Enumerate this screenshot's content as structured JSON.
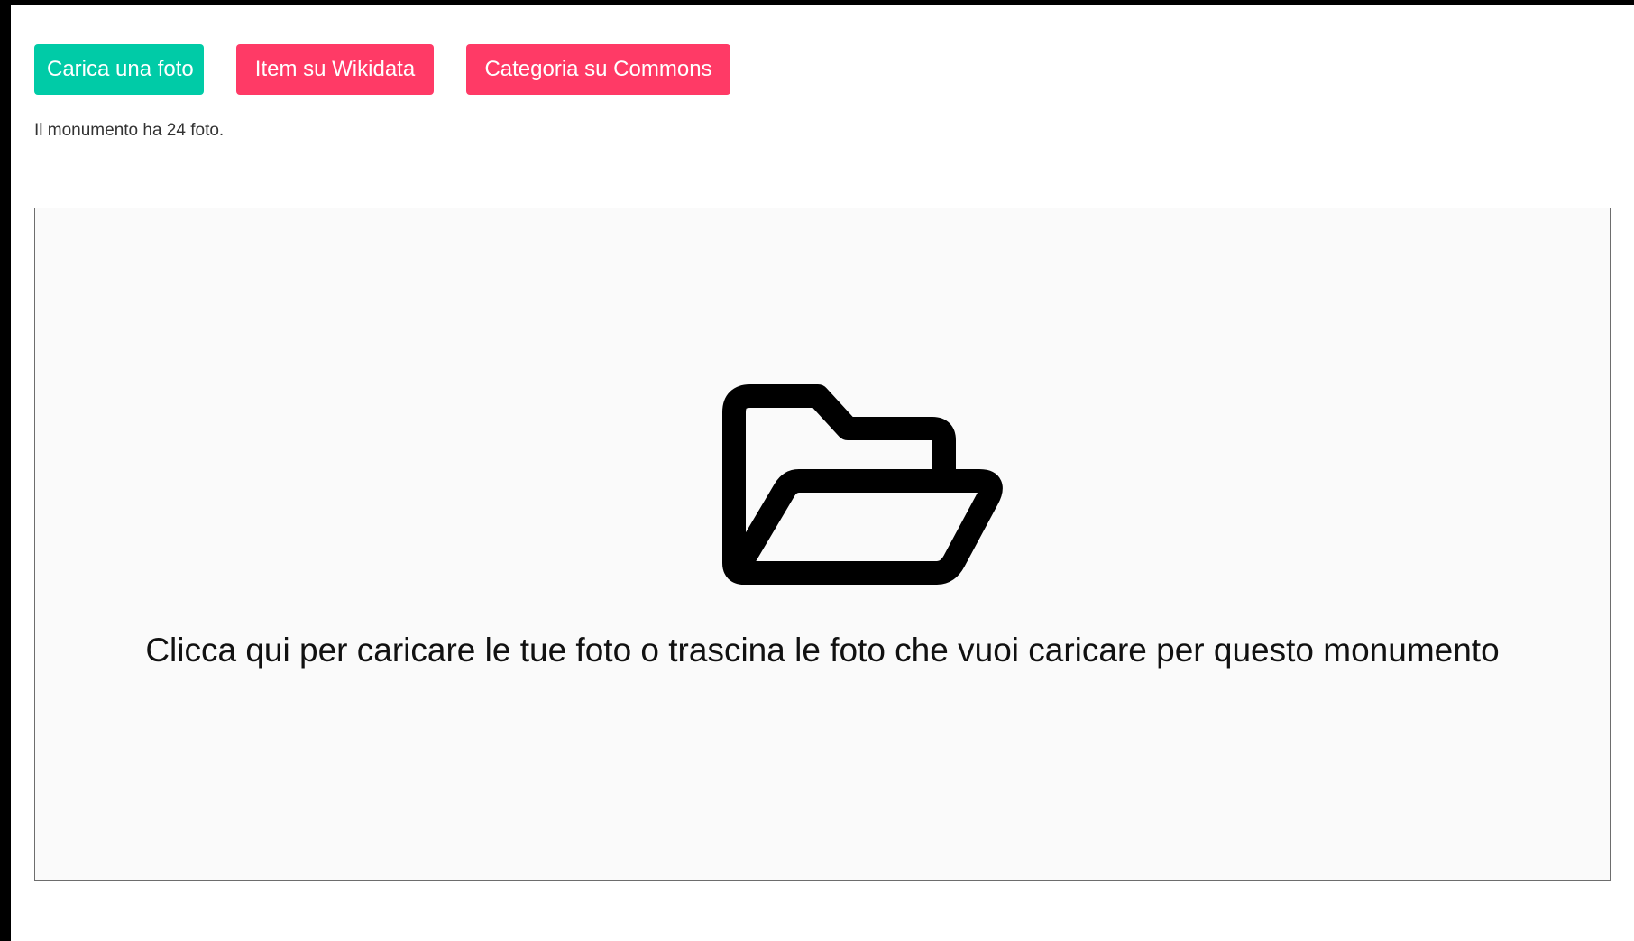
{
  "actions": {
    "upload_label": "Carica una foto",
    "wikidata_label": "Item su Wikidata",
    "commons_label": "Categoria su Commons"
  },
  "photo_count_text": "Il monumento ha 24 foto.",
  "dropzone": {
    "icon": "folder-open-icon",
    "message": "Clicca qui per caricare le tue foto o trascina le foto che vuoi caricare per questo monumento"
  },
  "colors": {
    "upload_button": "#00cba7",
    "link_buttons": "#ff3a66",
    "dropzone_background": "#fafafa"
  }
}
